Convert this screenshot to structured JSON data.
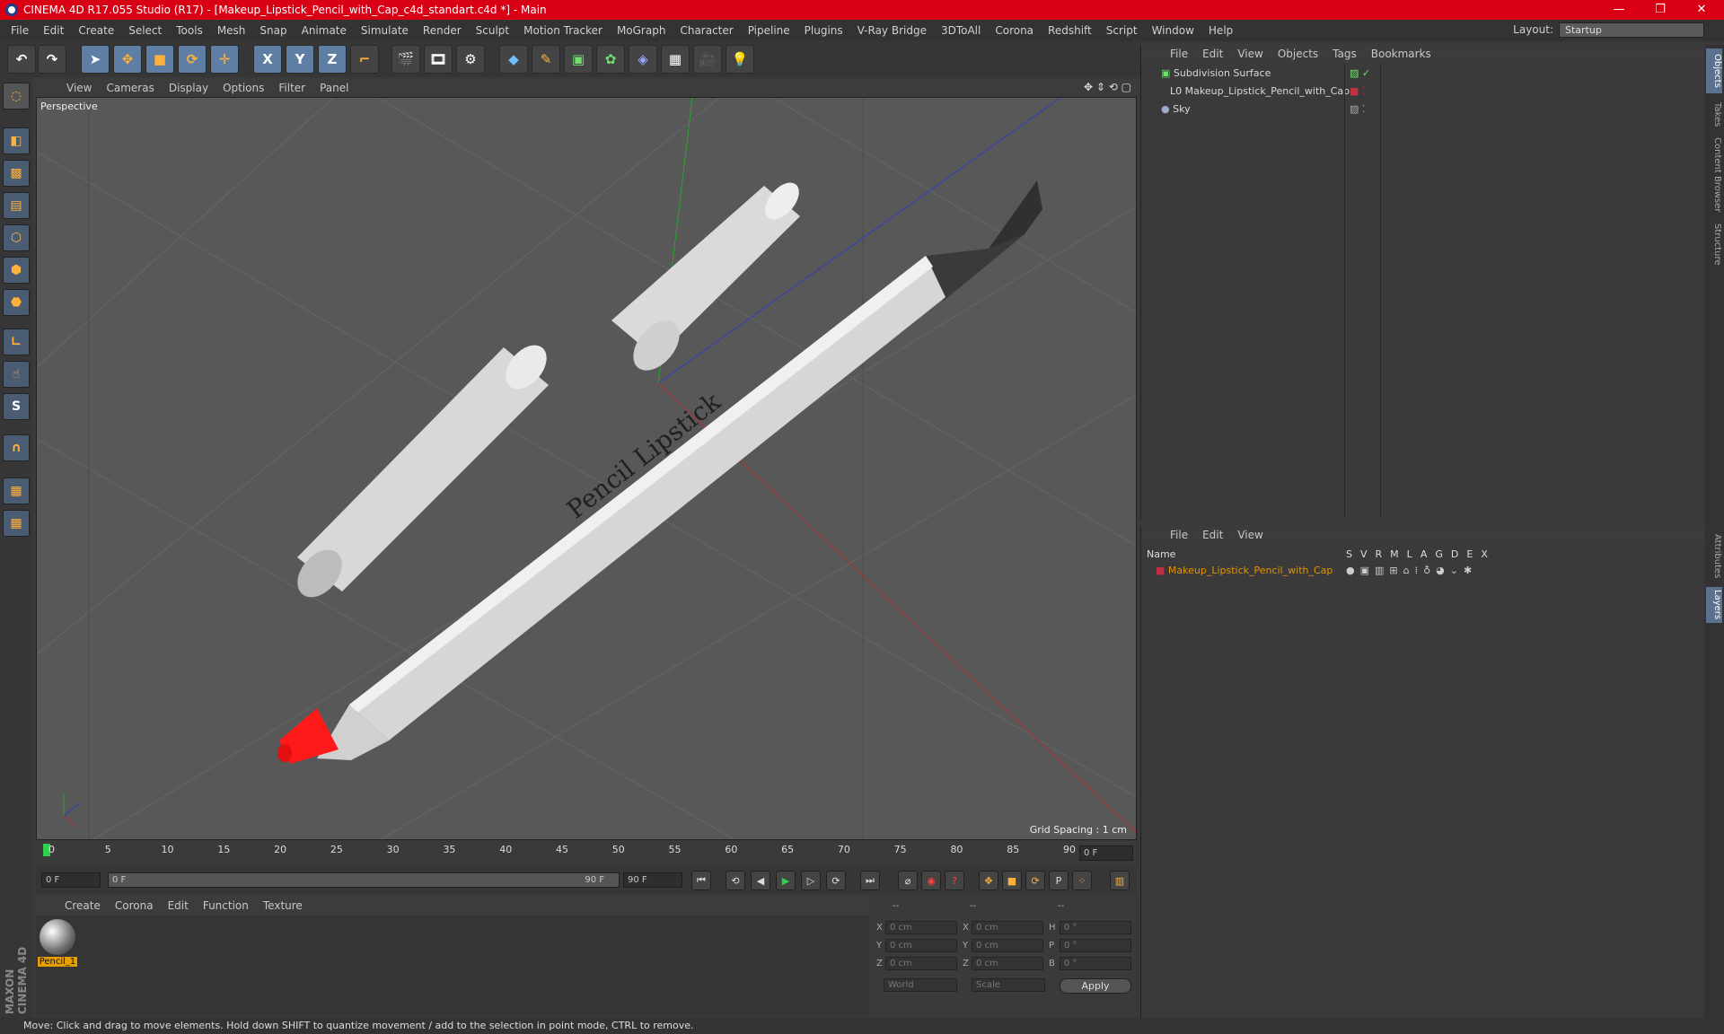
{
  "window": {
    "title": "CINEMA 4D R17.055 Studio (R17) - [Makeup_Lipstick_Pencil_with_Cap_c4d_standart.c4d *] - Main",
    "min": "—",
    "max": "❐",
    "close": "✕"
  },
  "menu": [
    "File",
    "Edit",
    "Create",
    "Select",
    "Tools",
    "Mesh",
    "Snap",
    "Animate",
    "Simulate",
    "Render",
    "Sculpt",
    "Motion Tracker",
    "MoGraph",
    "Character",
    "Pipeline",
    "Plugins",
    "V-Ray Bridge",
    "3DToAll",
    "Corona",
    "Redshift",
    "Script",
    "Window",
    "Help"
  ],
  "layout": {
    "label": "Layout:",
    "value": "Startup"
  },
  "toolbar": {
    "x": "X",
    "y": "Y",
    "z": "Z"
  },
  "viewport": {
    "menu": [
      "View",
      "Cameras",
      "Display",
      "Options",
      "Filter",
      "Panel"
    ],
    "camera": "Perspective",
    "grid_spacing": "Grid Spacing : 1 cm",
    "label_text": "Pencil Lipstick"
  },
  "timeline": {
    "ticks": [
      "0",
      "5",
      "10",
      "15",
      "20",
      "25",
      "30",
      "35",
      "40",
      "45",
      "50",
      "55",
      "60",
      "65",
      "70",
      "75",
      "80",
      "85",
      "90"
    ],
    "current": "0 F"
  },
  "playback": {
    "start": "0 F",
    "range_start": "0 F",
    "range_end": "90 F",
    "end": "90 F"
  },
  "materials": {
    "menu": [
      "Create",
      "Corona",
      "Edit",
      "Function",
      "Texture"
    ],
    "items": [
      {
        "name": "Pencil_1"
      }
    ]
  },
  "coords": {
    "header": [
      "--",
      "--",
      "--"
    ],
    "rows": [
      {
        "a": "X",
        "v1": "0 cm",
        "b": "X",
        "v2": "0 cm",
        "c": "H",
        "v3": "0 °"
      },
      {
        "a": "Y",
        "v1": "0 cm",
        "b": "Y",
        "v2": "0 cm",
        "c": "P",
        "v3": "0 °"
      },
      {
        "a": "Z",
        "v1": "0 cm",
        "b": "Z",
        "v2": "0 cm",
        "c": "B",
        "v3": "0 °"
      }
    ],
    "world": "World",
    "scale": "Scale",
    "apply": "Apply"
  },
  "objects": {
    "menu": [
      "File",
      "Edit",
      "View",
      "Objects",
      "Tags",
      "Bookmarks"
    ],
    "items": [
      {
        "name": "Subdivision Surface"
      },
      {
        "name": "Makeup_Lipstick_Pencil_with_Cap"
      },
      {
        "name": "Sky"
      }
    ]
  },
  "layers": {
    "menu": [
      "File",
      "Edit",
      "View"
    ],
    "header": "Name",
    "cols": [
      "S",
      "V",
      "R",
      "M",
      "L",
      "A",
      "G",
      "D",
      "E",
      "X"
    ],
    "items": [
      {
        "name": "Makeup_Lipstick_Pencil_with_Cap"
      }
    ]
  },
  "right_tabs": [
    "Objects",
    "Takes",
    "Content Browser",
    "Structure",
    "Attributes",
    "Layers"
  ],
  "status": "Move: Click and drag to move elements. Hold down SHIFT to quantize movement / add to the selection in point mode, CTRL to remove.",
  "brand": "MAXON CINEMA 4D",
  "colors": {
    "title_bar": "#d90015",
    "viewport_bg": "#585858",
    "lipstick_tip": "#e01010",
    "selected_layer": "#e59400"
  }
}
